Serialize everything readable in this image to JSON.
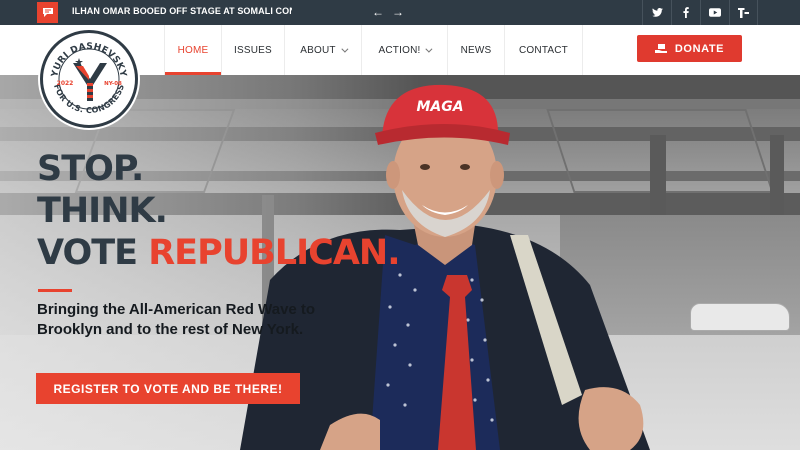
{
  "topbar": {
    "news_headline": "ILHAN OMAR BOOED OFF STAGE AT SOMALI CON...",
    "prev_arrow": "←",
    "next_arrow": "→",
    "social": [
      {
        "name": "twitter-icon",
        "glyph": "t"
      },
      {
        "name": "facebook-icon",
        "glyph": "f"
      },
      {
        "name": "youtube-icon",
        "glyph": "▶"
      },
      {
        "name": "truth-social-icon",
        "glyph": "T"
      }
    ]
  },
  "logo": {
    "top_text": "YURI DASHEVSKY",
    "bottom_text": "FOR U.S. CONGRESS",
    "year": "2022",
    "district": "NY-08"
  },
  "nav": {
    "items": [
      {
        "label": "HOME",
        "active": true,
        "dropdown": false
      },
      {
        "label": "ISSUES",
        "active": false,
        "dropdown": false
      },
      {
        "label": "ABOUT",
        "active": false,
        "dropdown": true
      },
      {
        "label": "ACTION!",
        "active": false,
        "dropdown": true
      },
      {
        "label": "NEWS",
        "active": false,
        "dropdown": false
      },
      {
        "label": "CONTACT",
        "active": false,
        "dropdown": false
      }
    ],
    "donate_label": "DONATE"
  },
  "hero": {
    "line1": "STOP.",
    "line2": "THINK.",
    "line3_prefix": "VOTE ",
    "line3_highlight": "REPUBLICAN.",
    "tagline": "Bringing the All-American Red Wave to Brooklyn and to the rest of New York.",
    "cta_label": "REGISTER TO VOTE AND BE THERE!",
    "hat_text": "MAGA"
  },
  "colors": {
    "accent": "#e8432f",
    "dark": "#2f3b45",
    "topbar": "#2f3b45"
  }
}
